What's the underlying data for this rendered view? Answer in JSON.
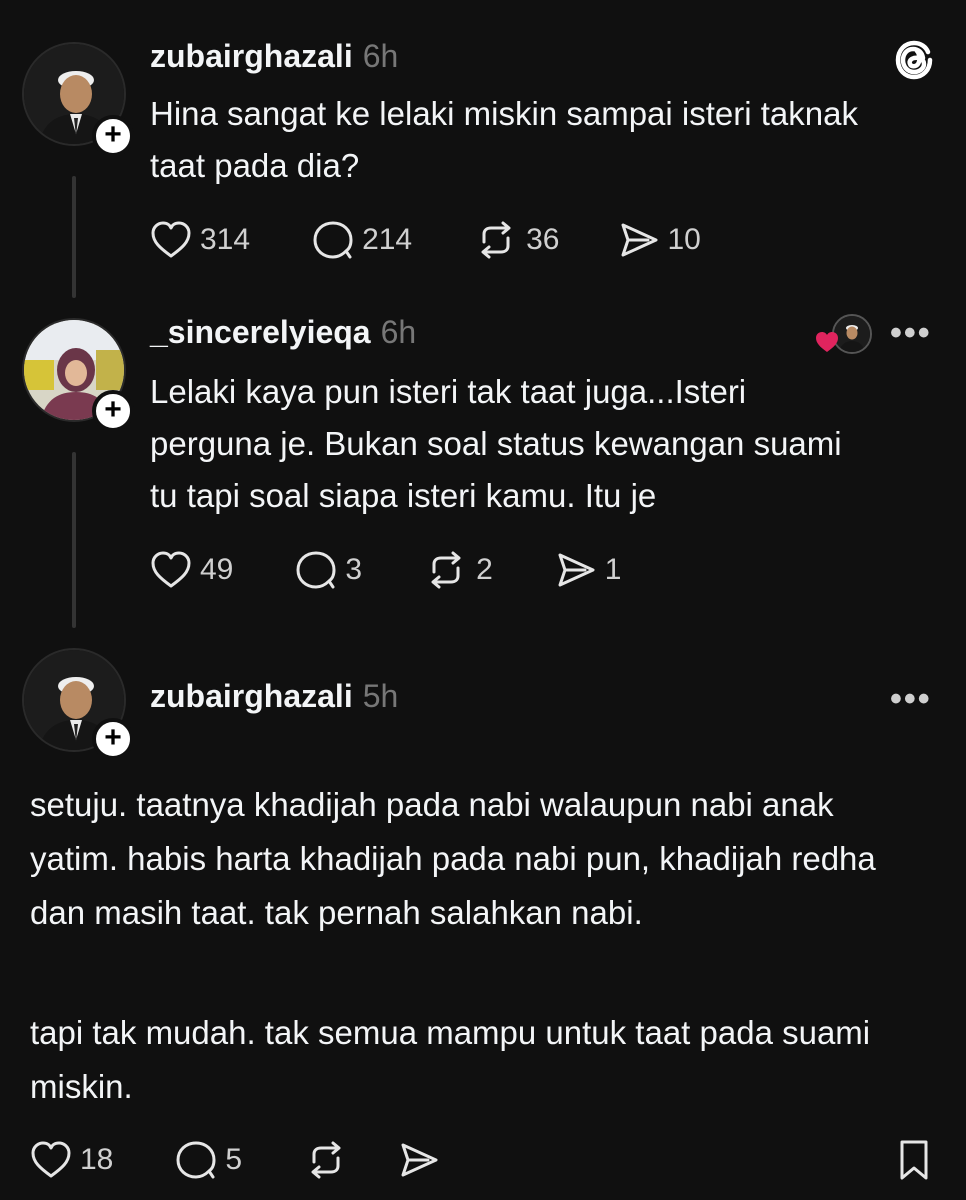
{
  "posts": [
    {
      "username": "zubairghazali",
      "time": "6h",
      "text": "Hina sangat ke lelaki miskin sampai isteri taknak taat pada dia?",
      "likes": "314",
      "comments": "214",
      "reposts": "36",
      "shares": "10"
    },
    {
      "username": "_sincerelyieqa",
      "time": "6h",
      "text": "Lelaki kaya pun isteri tak taat juga...Isteri perguna je. Bukan soal status kewangan suami tu tapi soal siapa isteri kamu. Itu je",
      "likes": "49",
      "comments": "3",
      "reposts": "2",
      "shares": "1"
    },
    {
      "username": "zubairghazali",
      "time": "5h",
      "paragraphs": [
        "setuju. taatnya khadijah pada nabi walaupun nabi anak yatim. habis harta khadijah pada nabi pun, khadijah redha dan masih taat. tak pernah salahkan nabi.",
        "tapi tak mudah. tak semua mampu untuk taat pada suami miskin."
      ],
      "likes": "18",
      "comments": "5"
    }
  ],
  "colors": {
    "background": "#101010",
    "text": "#f3f5f7",
    "muted": "#777777",
    "like_red": "#e0245e"
  },
  "icons": [
    "threads-logo-icon",
    "heart-icon",
    "comment-icon",
    "repost-icon",
    "share-icon",
    "bookmark-icon",
    "more-icon",
    "plus-icon"
  ]
}
